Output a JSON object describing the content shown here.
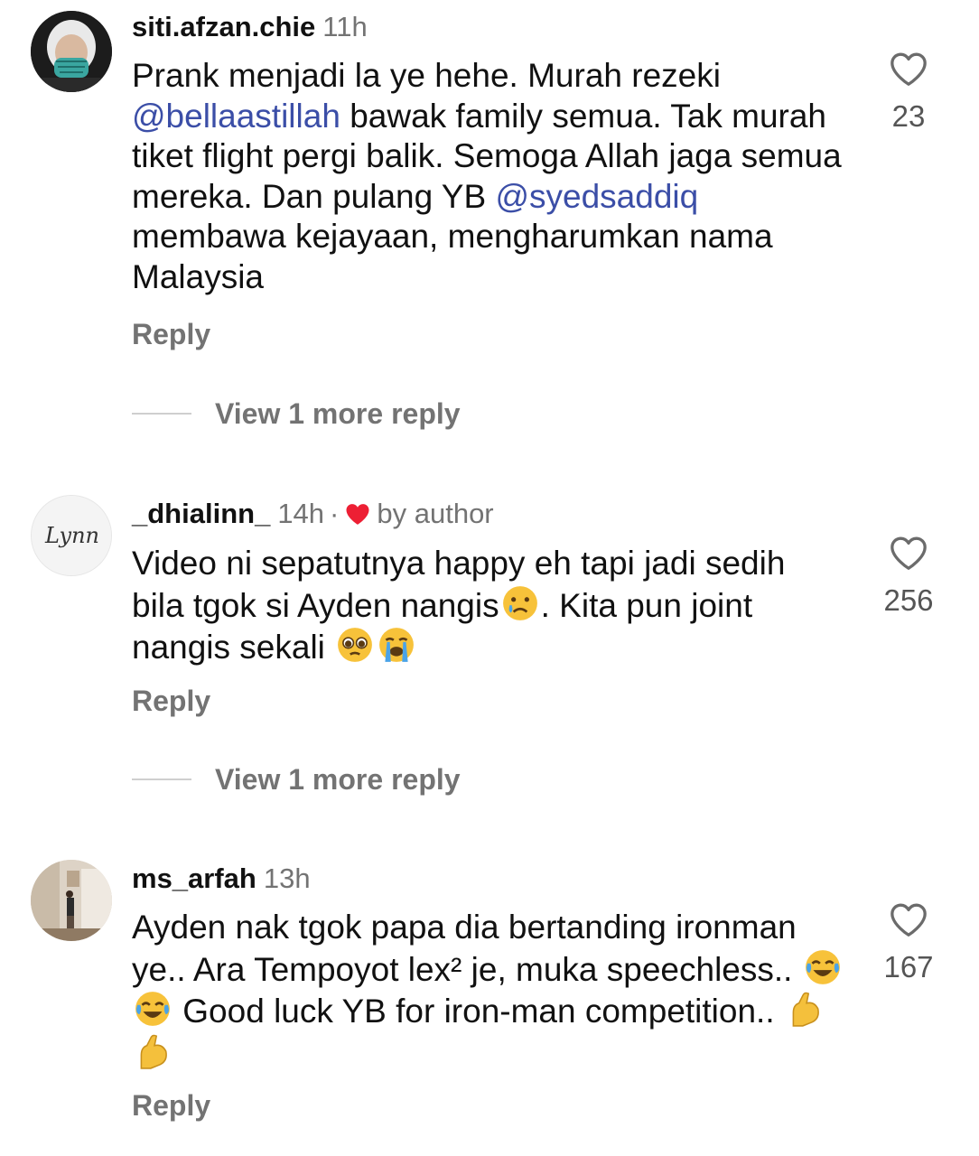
{
  "comments": [
    {
      "username": "siti.afzan.chie",
      "time": "11h",
      "text_parts": [
        "Prank menjadi la ye hehe. Murah rezeki ",
        "@bellaastillah",
        " bawak family semua. Tak murah tiket flight pergi balik. Semoga Allah jaga semua mereka. Dan pulang YB ",
        "@syedsaddiq",
        " membawa kejayaan, mengharumkan nama Malaysia"
      ],
      "likes": "23",
      "reply_label": "Reply",
      "view_more": "View 1 more reply"
    },
    {
      "username": "_dhialinn_",
      "time": "14h",
      "separator": "·",
      "liked_by_author": "by author",
      "avatar_text": "Lynn",
      "text_parts": [
        "Video ni sepatutnya happy eh tapi jadi sedih bila tgok si Ayden nangis",
        ". Kita pun joint nangis sekali "
      ],
      "emojis": [
        "crying-face",
        "pleading-face",
        "loudly-crying-face"
      ],
      "likes": "256",
      "reply_label": "Reply",
      "view_more": "View 1 more reply"
    },
    {
      "username": "ms_arfah",
      "time": "13h",
      "text_parts": [
        "Ayden nak tgok papa dia bertanding ironman ye.. Ara Tempoyot lex² je, muka speechless.. ",
        " Good luck YB for iron-man competition.. "
      ],
      "emojis": [
        "tears-of-joy",
        "tears-of-joy",
        "flexed-biceps",
        "flexed-biceps"
      ],
      "likes": "167",
      "reply_label": "Reply"
    }
  ],
  "colors": {
    "mention": "#3b4ea7",
    "secondary_text": "#737373",
    "heart_red": "#ed1f34"
  }
}
